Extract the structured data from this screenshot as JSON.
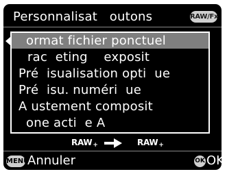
{
  "header": {
    "title": "Personnalisat   outons",
    "raw_fx_badge": "RAW/Fx"
  },
  "menu": {
    "selected_index": 0,
    "items": [
      {
        "label": "ormat fichier ponctuel"
      },
      {
        "label": "rac  eting    exposit"
      },
      {
        "label": "Pré  isualisation opti  ue"
      },
      {
        "label": "Pré  isu. numéri  ue"
      },
      {
        "label": "A ustement composit"
      },
      {
        "label": "one acti  e A"
      }
    ]
  },
  "footer": {
    "raw_from": "RAW",
    "raw_to": "RAW",
    "raw_plus_symbol": "+",
    "menu_badge": "MENU",
    "cancel_label": "Annuler",
    "ok_badge": "OK",
    "ok_label": "OK"
  },
  "colors": {
    "background": "#000000",
    "highlight": "#7f7f7f",
    "text": "#ffffff",
    "badge": "#cfcfcf"
  },
  "icons": {
    "back": "chevron-left-icon",
    "convert": "arrow-right-icon"
  }
}
